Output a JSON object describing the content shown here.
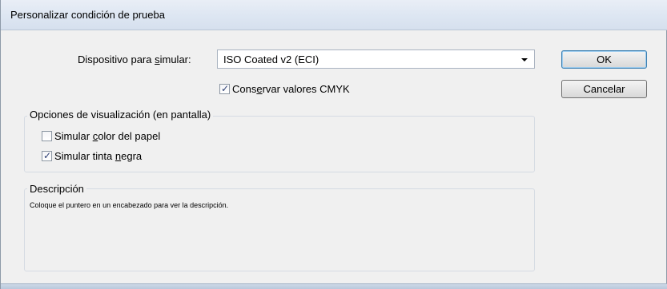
{
  "window": {
    "title": "Personalizar condición de prueba"
  },
  "device": {
    "label_pre": "Dispositivo para ",
    "label_u": "s",
    "label_post": "imular:",
    "value": "ISO Coated v2 (ECI)"
  },
  "preserve_cmyk": {
    "label_pre": "Cons",
    "label_u": "e",
    "label_post": "rvar valores CMYK",
    "checked": true
  },
  "buttons": {
    "ok": "OK",
    "cancel": "Cancelar"
  },
  "display_options": {
    "title": "Opciones de visualización (en pantalla)",
    "simulate_paper": {
      "label_pre": "Simular ",
      "label_u": "c",
      "label_post": "olor del papel",
      "checked": false
    },
    "simulate_ink": {
      "label_pre": "Simular tinta ",
      "label_u": "n",
      "label_post": "egra",
      "checked": true
    }
  },
  "description": {
    "title": "Descripción",
    "text": "Coloque el puntero en un encabezado para ver la descripción."
  }
}
